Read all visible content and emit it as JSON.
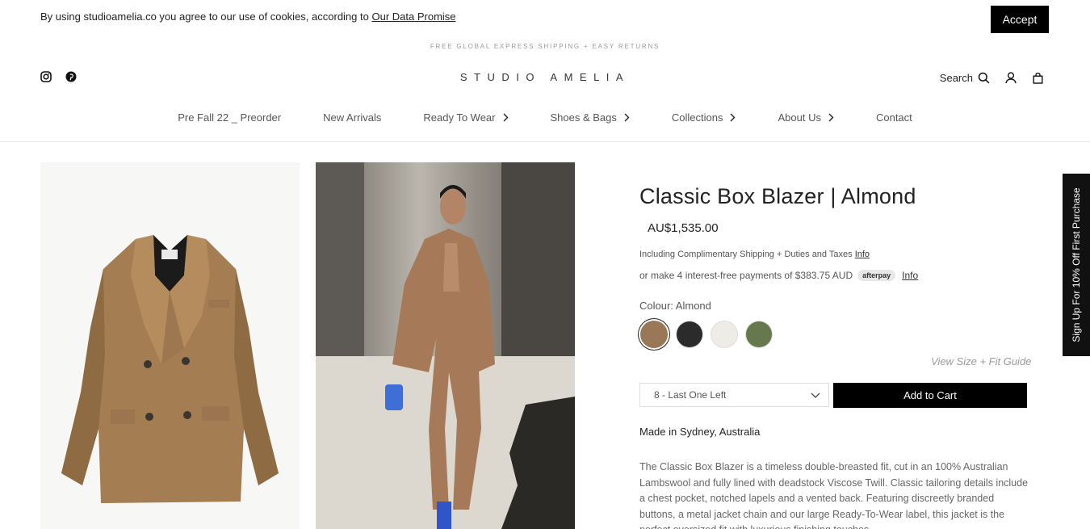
{
  "cookie": {
    "text": "By using studioamelia.co you agree to our use of cookies, according to",
    "link": "Our Data Promise",
    "accept": "Accept"
  },
  "promo": "FREE GLOBAL EXPRESS SHIPPING + EASY RETURNS",
  "logo": "STUDIO AMELIA",
  "header": {
    "search_label": "Search"
  },
  "icons": {
    "social": [
      "instagram-icon",
      "pinterest-icon"
    ],
    "tools": [
      "search-icon",
      "account-icon",
      "bag-icon"
    ]
  },
  "nav": [
    {
      "label": "Pre Fall 22 _ Preorder"
    },
    {
      "label": "New Arrivals"
    },
    {
      "label": "Ready To Wear"
    },
    {
      "label": "Shoes & Bags"
    },
    {
      "label": "Collections"
    },
    {
      "label": "About Us"
    },
    {
      "label": "Contact"
    }
  ],
  "product": {
    "title": "Classic Box Blazer | Almond",
    "price": "AU$1,535.00",
    "shipping": "Including Complimentary Shipping + Duties and Taxes",
    "shipping_info": "Info",
    "afterpay_text": "or make 4 interest-free payments of $383.75 AUD",
    "afterpay_badge": "afterpay",
    "afterpay_info": "Info",
    "colour_label": "Colour: Almond",
    "swatches": [
      {
        "name": "Almond",
        "color": "#9a7756"
      },
      {
        "name": "Black",
        "color": "#2b2b2b"
      },
      {
        "name": "Ivory",
        "color": "#eeece6"
      },
      {
        "name": "Olive",
        "color": "#66794e"
      }
    ],
    "fit_guide": "View Size + Fit Guide",
    "size_selected": "8 - Last One Left",
    "add_to_cart": "Add to Cart",
    "made_in": "Made in Sydney, Australia",
    "description": "The Classic Box Blazer is a timeless double-breasted fit, cut in an 100% Australian Lambswool and fully lined with deadstock Viscose Twill. Classic tailoring details include a chest pocket, notched lapels and a vented back. Featuring discreetly branded buttons, a metal jacket chain and our large Ready-To-Wear label, this jacket is the perfect oversized fit with luxurious finishing touches."
  },
  "side_tab": "Sign Up For 10% Off First Purchase"
}
